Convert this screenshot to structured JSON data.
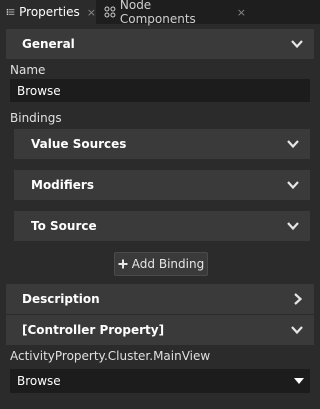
{
  "tabs": [
    {
      "label": "Properties",
      "icon": "list-icon",
      "active": true
    },
    {
      "label": "Node Components",
      "icon": "node-components-icon",
      "active": false
    }
  ],
  "tab_close": "×",
  "sections": {
    "general": {
      "title": "General"
    },
    "name_label": "Name",
    "name_value": "Browse",
    "bindings_label": "Bindings",
    "value_sources": "Value Sources",
    "modifiers": "Modifiers",
    "to_source": "To Source",
    "add_binding": "Add Binding",
    "description": "Description",
    "controller_property": "[Controller Property]",
    "activity_label": "ActivityProperty.Cluster.MainView",
    "activity_value": "Browse"
  },
  "colors": {
    "panel_bg": "#2b2b2b",
    "tab_bar_bg": "#1e1e1e",
    "header_bg": "#3a3a3a",
    "field_bg": "#1c1c1c"
  }
}
